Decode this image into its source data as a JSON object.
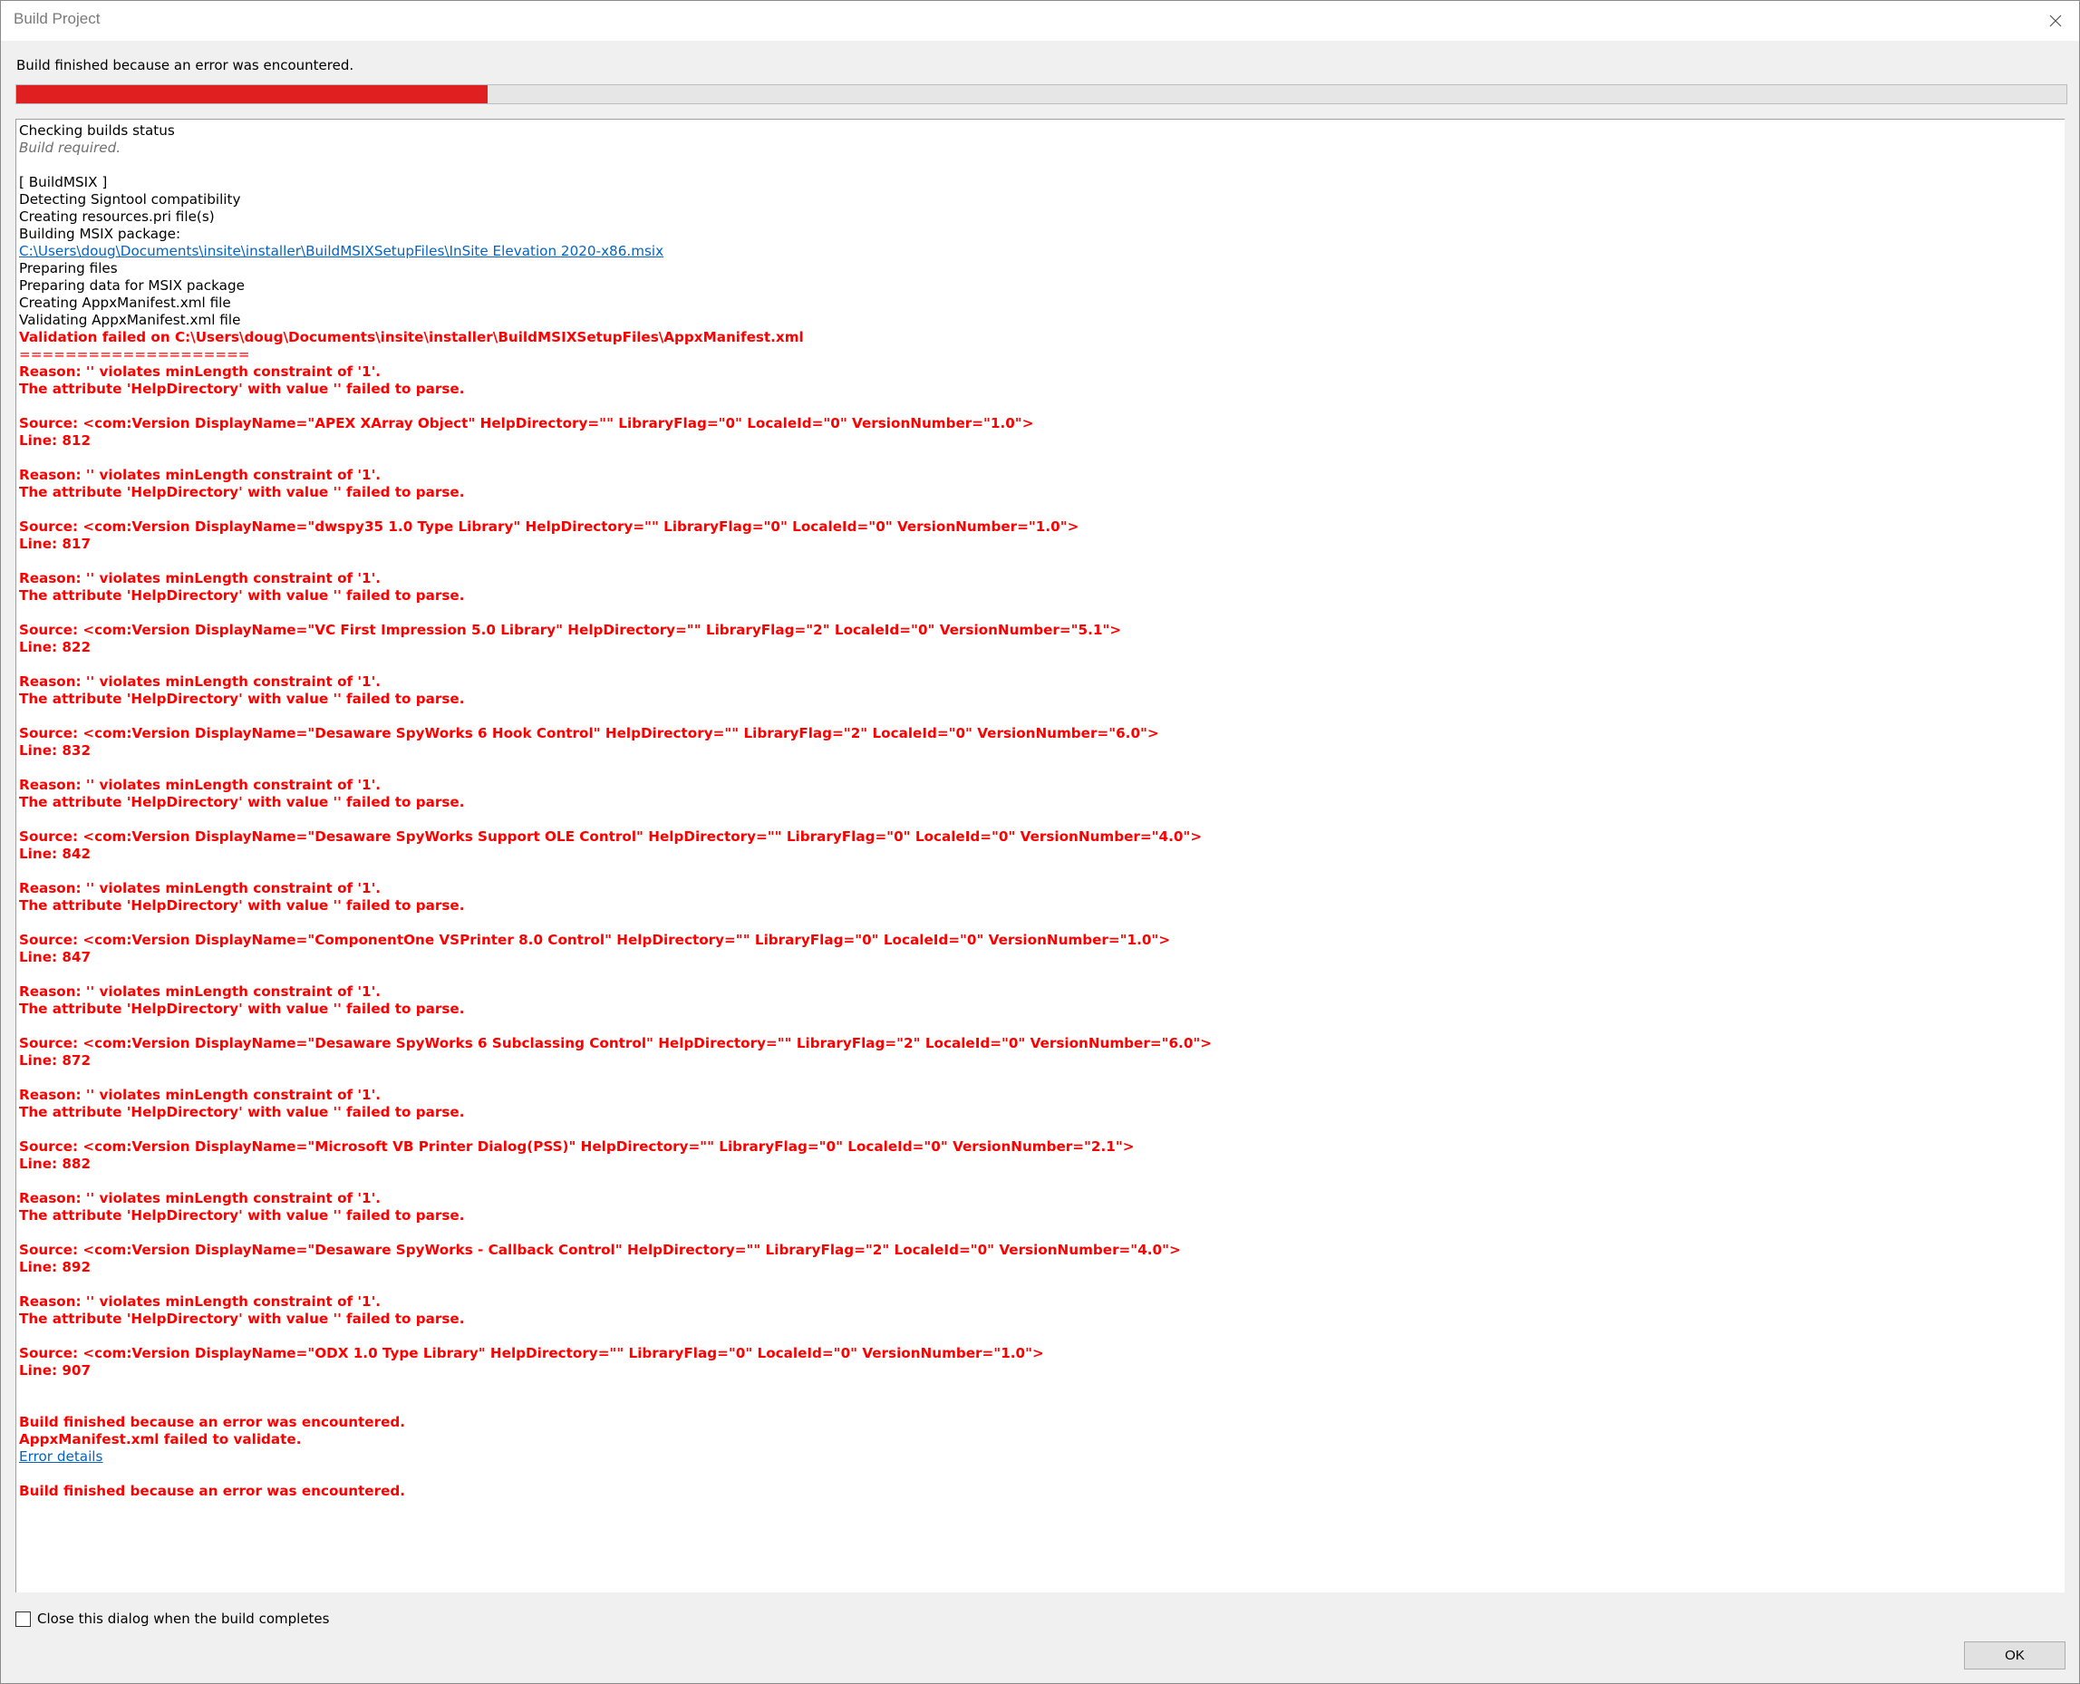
{
  "window": {
    "title": "Build Project",
    "close_icon": "close-icon"
  },
  "status": {
    "message": "Build finished because an error was encountered.",
    "progress_fraction": 0.23,
    "progress_color": "#e02020"
  },
  "log": {
    "lines": [
      {
        "text": "Checking builds status",
        "style": "normal"
      },
      {
        "text": "Build required.",
        "style": "italic"
      },
      {
        "text": "",
        "style": "normal"
      },
      {
        "text": "[ BuildMSIX ]",
        "style": "normal"
      },
      {
        "text": "Detecting Signtool compatibility",
        "style": "normal"
      },
      {
        "text": "Creating resources.pri file(s)",
        "style": "normal"
      },
      {
        "text": "Building MSIX package:",
        "style": "normal"
      },
      {
        "text": "C:\\Users\\doug\\Documents\\insite\\installer\\BuildMSIXSetupFiles\\InSite Elevation 2020-x86.msix",
        "style": "link"
      },
      {
        "text": "Preparing files",
        "style": "normal"
      },
      {
        "text": "Preparing data for MSIX package",
        "style": "normal"
      },
      {
        "text": "Creating AppxManifest.xml file",
        "style": "normal"
      },
      {
        "text": "Validating AppxManifest.xml file",
        "style": "normal"
      },
      {
        "text": "Validation failed on C:\\Users\\doug\\Documents\\insite\\installer\\BuildMSIXSetupFiles\\AppxManifest.xml",
        "style": "err"
      },
      {
        "text": "====================",
        "style": "sep"
      },
      {
        "text": "Reason: '' violates minLength constraint of '1'.",
        "style": "err"
      },
      {
        "text": "The attribute 'HelpDirectory' with value '' failed to parse.",
        "style": "err"
      },
      {
        "text": "",
        "style": "normal"
      },
      {
        "text": "Source: <com:Version DisplayName=\"APEX XArray Object\" HelpDirectory=\"\" LibraryFlag=\"0\" LocaleId=\"0\" VersionNumber=\"1.0\">",
        "style": "err"
      },
      {
        "text": "Line: 812",
        "style": "err"
      },
      {
        "text": "",
        "style": "normal"
      },
      {
        "text": "Reason: '' violates minLength constraint of '1'.",
        "style": "err"
      },
      {
        "text": "The attribute 'HelpDirectory' with value '' failed to parse.",
        "style": "err"
      },
      {
        "text": "",
        "style": "normal"
      },
      {
        "text": "Source: <com:Version DisplayName=\"dwspy35 1.0 Type Library\" HelpDirectory=\"\" LibraryFlag=\"0\" LocaleId=\"0\" VersionNumber=\"1.0\">",
        "style": "err"
      },
      {
        "text": "Line: 817",
        "style": "err"
      },
      {
        "text": "",
        "style": "normal"
      },
      {
        "text": "Reason: '' violates minLength constraint of '1'.",
        "style": "err"
      },
      {
        "text": "The attribute 'HelpDirectory' with value '' failed to parse.",
        "style": "err"
      },
      {
        "text": "",
        "style": "normal"
      },
      {
        "text": "Source: <com:Version DisplayName=\"VC First Impression 5.0 Library\" HelpDirectory=\"\" LibraryFlag=\"2\" LocaleId=\"0\" VersionNumber=\"5.1\">",
        "style": "err"
      },
      {
        "text": "Line: 822",
        "style": "err"
      },
      {
        "text": "",
        "style": "normal"
      },
      {
        "text": "Reason: '' violates minLength constraint of '1'.",
        "style": "err"
      },
      {
        "text": "The attribute 'HelpDirectory' with value '' failed to parse.",
        "style": "err"
      },
      {
        "text": "",
        "style": "normal"
      },
      {
        "text": "Source: <com:Version DisplayName=\"Desaware SpyWorks 6 Hook Control\" HelpDirectory=\"\" LibraryFlag=\"2\" LocaleId=\"0\" VersionNumber=\"6.0\">",
        "style": "err"
      },
      {
        "text": "Line: 832",
        "style": "err"
      },
      {
        "text": "",
        "style": "normal"
      },
      {
        "text": "Reason: '' violates minLength constraint of '1'.",
        "style": "err"
      },
      {
        "text": "The attribute 'HelpDirectory' with value '' failed to parse.",
        "style": "err"
      },
      {
        "text": "",
        "style": "normal"
      },
      {
        "text": "Source: <com:Version DisplayName=\"Desaware SpyWorks Support OLE Control\" HelpDirectory=\"\" LibraryFlag=\"0\" LocaleId=\"0\" VersionNumber=\"4.0\">",
        "style": "err"
      },
      {
        "text": "Line: 842",
        "style": "err"
      },
      {
        "text": "",
        "style": "normal"
      },
      {
        "text": "Reason: '' violates minLength constraint of '1'.",
        "style": "err"
      },
      {
        "text": "The attribute 'HelpDirectory' with value '' failed to parse.",
        "style": "err"
      },
      {
        "text": "",
        "style": "normal"
      },
      {
        "text": "Source: <com:Version DisplayName=\"ComponentOne VSPrinter 8.0 Control\" HelpDirectory=\"\" LibraryFlag=\"0\" LocaleId=\"0\" VersionNumber=\"1.0\">",
        "style": "err"
      },
      {
        "text": "Line: 847",
        "style": "err"
      },
      {
        "text": "",
        "style": "normal"
      },
      {
        "text": "Reason: '' violates minLength constraint of '1'.",
        "style": "err"
      },
      {
        "text": "The attribute 'HelpDirectory' with value '' failed to parse.",
        "style": "err"
      },
      {
        "text": "",
        "style": "normal"
      },
      {
        "text": "Source: <com:Version DisplayName=\"Desaware SpyWorks 6 Subclassing Control\" HelpDirectory=\"\" LibraryFlag=\"2\" LocaleId=\"0\" VersionNumber=\"6.0\">",
        "style": "err"
      },
      {
        "text": "Line: 872",
        "style": "err"
      },
      {
        "text": "",
        "style": "normal"
      },
      {
        "text": "Reason: '' violates minLength constraint of '1'.",
        "style": "err"
      },
      {
        "text": "The attribute 'HelpDirectory' with value '' failed to parse.",
        "style": "err"
      },
      {
        "text": "",
        "style": "normal"
      },
      {
        "text": "Source: <com:Version DisplayName=\"Microsoft VB Printer Dialog(PSS)\" HelpDirectory=\"\" LibraryFlag=\"0\" LocaleId=\"0\" VersionNumber=\"2.1\">",
        "style": "err"
      },
      {
        "text": "Line: 882",
        "style": "err"
      },
      {
        "text": "",
        "style": "normal"
      },
      {
        "text": "Reason: '' violates minLength constraint of '1'.",
        "style": "err"
      },
      {
        "text": "The attribute 'HelpDirectory' with value '' failed to parse.",
        "style": "err"
      },
      {
        "text": "",
        "style": "normal"
      },
      {
        "text": "Source: <com:Version DisplayName=\"Desaware SpyWorks - Callback Control\" HelpDirectory=\"\" LibraryFlag=\"2\" LocaleId=\"0\" VersionNumber=\"4.0\">",
        "style": "err"
      },
      {
        "text": "Line: 892",
        "style": "err"
      },
      {
        "text": "",
        "style": "normal"
      },
      {
        "text": "Reason: '' violates minLength constraint of '1'.",
        "style": "err"
      },
      {
        "text": "The attribute 'HelpDirectory' with value '' failed to parse.",
        "style": "err"
      },
      {
        "text": "",
        "style": "normal"
      },
      {
        "text": "Source: <com:Version DisplayName=\"ODX 1.0 Type Library\" HelpDirectory=\"\" LibraryFlag=\"0\" LocaleId=\"0\" VersionNumber=\"1.0\">",
        "style": "err"
      },
      {
        "text": "Line: 907",
        "style": "err"
      },
      {
        "text": "",
        "style": "normal"
      },
      {
        "text": "",
        "style": "normal"
      },
      {
        "text": "Build finished because an error was encountered.",
        "style": "err"
      },
      {
        "text": "AppxManifest.xml failed to validate.",
        "style": "err"
      },
      {
        "text": "Error details",
        "style": "link"
      },
      {
        "text": "",
        "style": "normal"
      },
      {
        "text": "Build finished because an error was encountered.",
        "style": "err"
      }
    ]
  },
  "footer": {
    "checkbox_label": "Close this dialog when the build completes",
    "checkbox_checked": false,
    "ok_label": "OK"
  }
}
